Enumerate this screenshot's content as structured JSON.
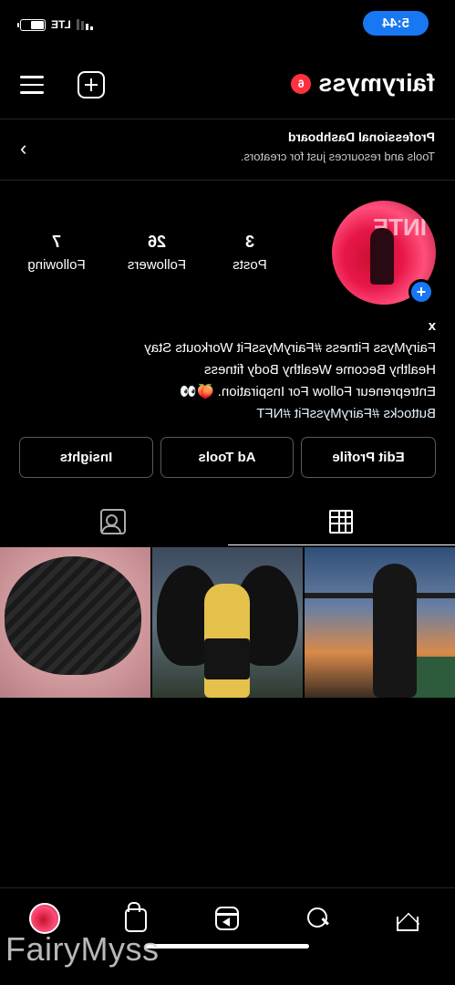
{
  "status_bar": {
    "time": "5:44",
    "network": "LTE"
  },
  "header": {
    "username": "fairymyss",
    "notification_count": "6"
  },
  "dashboard": {
    "title": "Professional Dashboard",
    "subtitle": "Tools and resources just for creators."
  },
  "stats": [
    {
      "count": "3",
      "label": "Posts"
    },
    {
      "count": "26",
      "label": "Followers"
    },
    {
      "count": "7",
      "label": "Following"
    }
  ],
  "bio": {
    "name": "x",
    "line1": "FairyMyss Fitness #FairyMyssFit Workouts Stay",
    "line2": "Healthy Become Wealthy Body fitness",
    "line3": "Entrepreneur Follow For Inspiration. 🍑👀",
    "line4": "Buttocks #FairyMyssFit #NFT"
  },
  "buttons": {
    "edit_profile": "Edit Profile",
    "ad_tools": "Ad Tools",
    "insights": "Insights"
  },
  "watermark": "FairyMyss"
}
